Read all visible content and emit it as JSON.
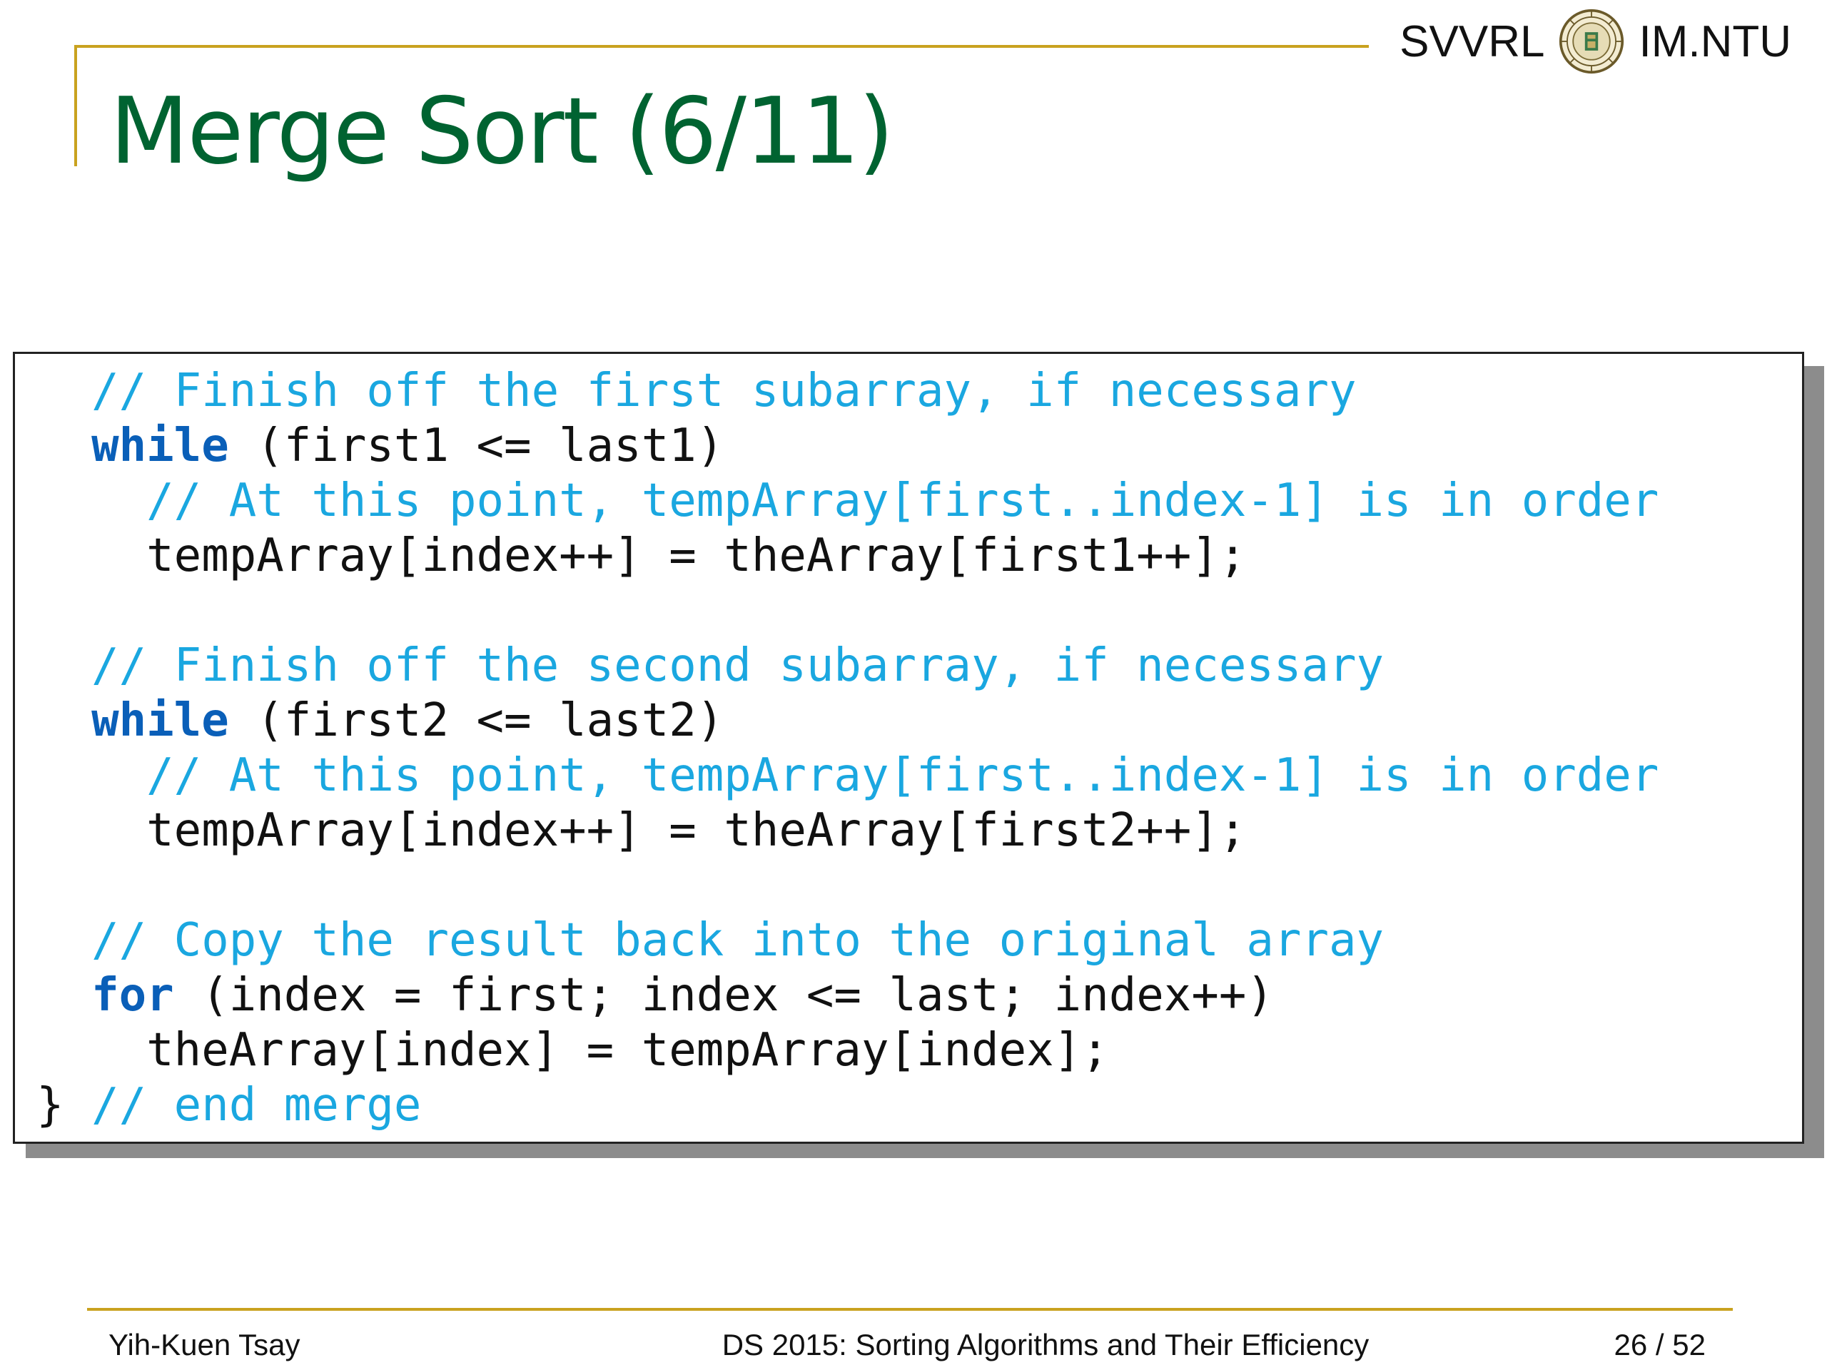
{
  "header": {
    "brand_left": "SVVRL",
    "brand_right": "IM.NTU",
    "seal_icon": "ntu-seal-icon"
  },
  "slide": {
    "title": "Merge Sort (6/11)"
  },
  "code": {
    "lines": [
      [
        {
          "t": "  "
        },
        {
          "t": "// Finish off the first subarray, if necessary",
          "c": "comment"
        }
      ],
      [
        {
          "t": "  "
        },
        {
          "t": "while",
          "c": "keyword"
        },
        {
          "t": " (first1 <= last1)"
        }
      ],
      [
        {
          "t": "    "
        },
        {
          "t": "// At this point, tempArray[first..index-1] is in order",
          "c": "comment"
        }
      ],
      [
        {
          "t": "    tempArray[index++] = theArray[first1++];"
        }
      ],
      [
        {
          "t": ""
        }
      ],
      [
        {
          "t": "  "
        },
        {
          "t": "// Finish off the second subarray, if necessary",
          "c": "comment"
        }
      ],
      [
        {
          "t": "  "
        },
        {
          "t": "while",
          "c": "keyword"
        },
        {
          "t": " (first2 <= last2)"
        }
      ],
      [
        {
          "t": "    "
        },
        {
          "t": "// At this point, tempArray[first..index-1] is in order",
          "c": "comment"
        }
      ],
      [
        {
          "t": "    tempArray[index++] = theArray[first2++];"
        }
      ],
      [
        {
          "t": ""
        }
      ],
      [
        {
          "t": "  "
        },
        {
          "t": "// Copy the result back into the original array",
          "c": "comment"
        }
      ],
      [
        {
          "t": "  "
        },
        {
          "t": "for",
          "c": "keyword"
        },
        {
          "t": " (index = first; index <= last; index++)"
        }
      ],
      [
        {
          "t": "    theArray[index] = tempArray[index];"
        }
      ],
      [
        {
          "t": "} "
        },
        {
          "t": "// end merge",
          "c": "comment"
        }
      ]
    ]
  },
  "footer": {
    "author": "Yih-Kuen Tsay",
    "course": "DS 2015: Sorting Algorithms and Their Efficiency",
    "page": "26 / 52"
  },
  "colors": {
    "title": "#006331",
    "rule": "#c9a21f",
    "comment": "#1aa7e0",
    "keyword": "#0a5fb8"
  }
}
